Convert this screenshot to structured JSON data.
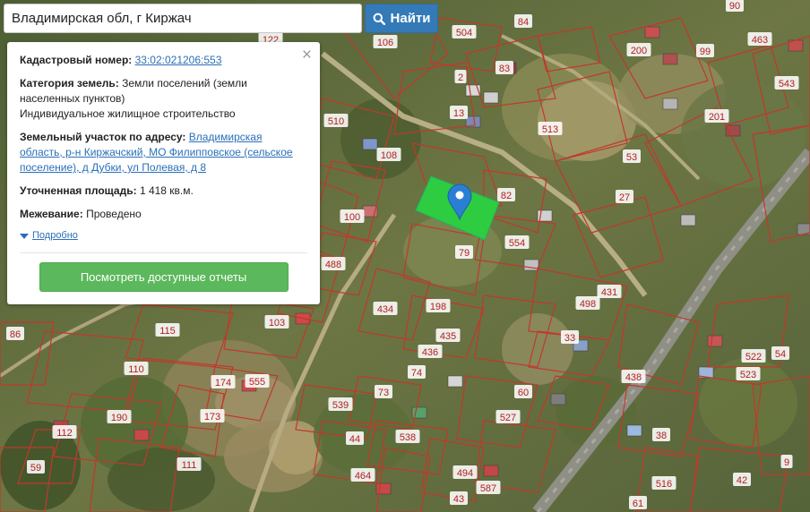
{
  "search": {
    "value": "Владимирская обл, г Киржач",
    "button_label": "Найти",
    "button_icon": "search-icon"
  },
  "info": {
    "cadastral_label": "Кадастровый номер:",
    "cadastral_value": "33:02:021206:553",
    "category_label": "Категория земель:",
    "category_line1": "Земли поселений (земли",
    "category_line2": "населенных пунктов)",
    "category_line3": "Индивидуальное жилищное строительство",
    "address_label": "Земельный участок по адресу:",
    "address_line1": "Владимирская",
    "address_line2": "область, р-н Киржачский, МО Филипповское (сельское",
    "address_line3": "поселение), д Дубки, ул Полевая, д 8",
    "area_label": "Уточненная площадь:",
    "area_value": "1 418 кв.м.",
    "survey_label": "Межевание:",
    "survey_value": "Проведено",
    "more_label": "Подробно",
    "reports_button": "Посмотреть доступные отчеты",
    "close_glyph": "×"
  },
  "colors": {
    "parcel_border": "#c0392b",
    "parcel_label_bg": "#ffffff",
    "selected_parcel": "#2ecc40",
    "marker": "#2a7fd4",
    "accent_blue": "#337ab7",
    "accent_green": "#5cb85c",
    "link": "#2a6fb8"
  },
  "map": {
    "parcel_numbers": [
      "122",
      "106",
      "504",
      "84",
      "90",
      "463",
      "200",
      "99",
      "543",
      "83",
      "2",
      "13",
      "510",
      "108",
      "513",
      "53",
      "201",
      "27",
      "82",
      "100",
      "554",
      "79",
      "488",
      "431",
      "498",
      "103",
      "434",
      "198",
      "115",
      "435",
      "436",
      "33",
      "86",
      "110",
      "174",
      "555",
      "74",
      "73",
      "60",
      "438",
      "522",
      "523",
      "54",
      "539",
      "527",
      "190",
      "112",
      "173",
      "44",
      "538",
      "38",
      "59",
      "111",
      "494",
      "587",
      "464",
      "516",
      "42",
      "9",
      "43",
      "61"
    ]
  }
}
